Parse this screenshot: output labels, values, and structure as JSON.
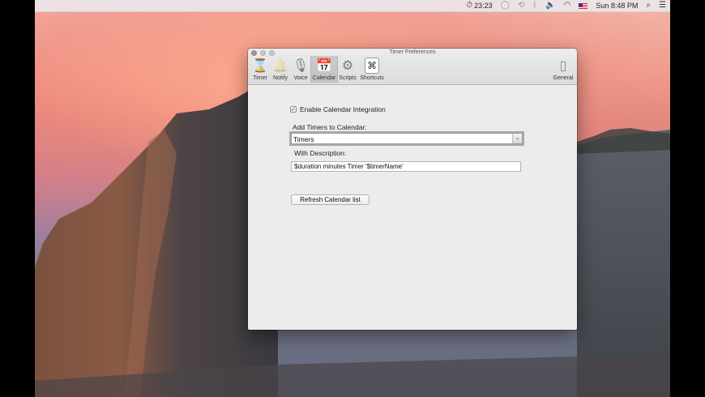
{
  "menubar": {
    "timer_time": "23:23",
    "clock": "Sun 8:48 PM",
    "icons": [
      "stopwatch-icon",
      "message-icon",
      "time-machine-icon",
      "bluetooth-icon",
      "volume-icon",
      "wifi-icon",
      "flag-icon",
      "search-icon",
      "list-icon"
    ]
  },
  "window": {
    "title": "Timer Preferences",
    "toolbar": [
      {
        "label": "Timer",
        "icon": "hourglass-icon",
        "glyph": "⌛"
      },
      {
        "label": "Notify",
        "icon": "bell-icon",
        "glyph": "🔔"
      },
      {
        "label": "Voice",
        "icon": "microphone-icon",
        "glyph": "🎙"
      },
      {
        "label": "Calendar",
        "icon": "calendar-icon",
        "glyph": "📅",
        "selected": true
      },
      {
        "label": "Scripts",
        "icon": "gear-icon",
        "glyph": "⚙"
      },
      {
        "label": "Shortcuts",
        "icon": "command-icon",
        "glyph": "⌘"
      }
    ],
    "general": {
      "label": "General",
      "icon": "switch-icon",
      "glyph": "▯"
    },
    "enable_integration": {
      "label": "Enable Calendar Integration",
      "checked": true
    },
    "add_timers_label": "Add Timers to Calendar:",
    "calendar_select": {
      "value": "Timers"
    },
    "description_label": "With Description:",
    "description_value": "$duration minutes Timer '$timerName'",
    "refresh_button": "Refresh Calendar list"
  }
}
